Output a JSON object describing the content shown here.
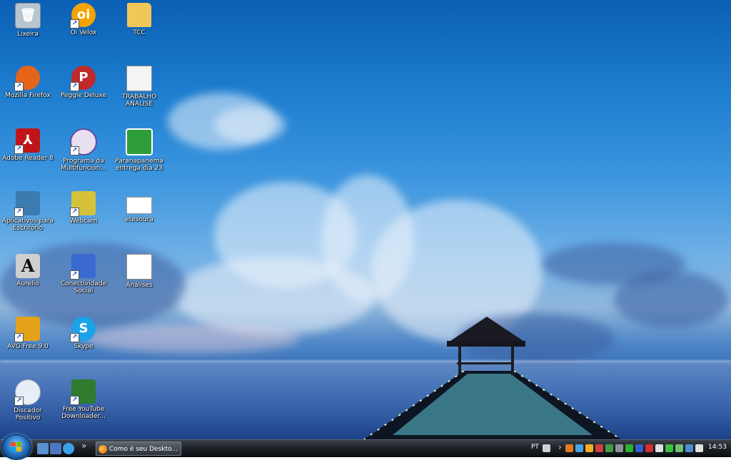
{
  "desktop": {
    "icons": [
      {
        "label": "Lixeira",
        "icon": "recycle-bin-icon",
        "color": "#b8c4d0",
        "symbol": "🗑"
      },
      {
        "label": "Oi Velox",
        "icon": "oi-velox-icon",
        "color": "#f5a300",
        "symbol": "oi"
      },
      {
        "label": "TCC",
        "icon": "folder-icon",
        "color": "#f1c75a",
        "symbol": ""
      },
      {
        "label": "Mozilla Firefox",
        "icon": "firefox-icon",
        "color": "#e5641a",
        "symbol": ""
      },
      {
        "label": "Peggle Deluxe",
        "icon": "peggle-icon",
        "color": "#c02a2a",
        "symbol": "P"
      },
      {
        "label": "TRABALHO ANALISE",
        "icon": "spreadsheet-document-icon",
        "color": "#f4f4f4",
        "symbol": ""
      },
      {
        "label": "Adobe Reader 8",
        "icon": "adobe-reader-icon",
        "color": "#c0141a",
        "symbol": "⅄"
      },
      {
        "label": "Programa da Multifuncion...",
        "icon": "multifunction-printer-icon",
        "color": "#e8e0f0",
        "symbol": ""
      },
      {
        "label": "Paranapanema entrega dia 23",
        "icon": "calc-spreadsheet-icon",
        "color": "#2e9e3a",
        "symbol": ""
      },
      {
        "label": "Aplicativos para Escritório",
        "icon": "office-apps-icon",
        "color": "#3a7bb0",
        "symbol": ""
      },
      {
        "label": "Webcam",
        "icon": "webcam-icon",
        "color": "#d6c23a",
        "symbol": ""
      },
      {
        "label": "etesoura",
        "icon": "document-icon",
        "color": "#ffffff",
        "symbol": ""
      },
      {
        "label": "Aurelio",
        "icon": "aurelio-dictionary-icon",
        "color": "#cfcfcf",
        "symbol": "A"
      },
      {
        "label": "Conectividade Social",
        "icon": "conectividade-social-icon",
        "color": "#3a6ad0",
        "symbol": ""
      },
      {
        "label": "Análises",
        "icon": "text-document-icon",
        "color": "#ffffff",
        "symbol": ""
      },
      {
        "label": "AVG Free 9.0",
        "icon": "avg-antivirus-icon",
        "color": "#e3a21a",
        "symbol": ""
      },
      {
        "label": "Skype",
        "icon": "skype-icon",
        "color": "#1aa3e8",
        "symbol": "S"
      },
      {
        "label": "Discador Positivo",
        "icon": "dialer-icon",
        "color": "#e8eef6",
        "symbol": ""
      },
      {
        "label": "Free YouTube Downloader...",
        "icon": "youtube-downloader-icon",
        "color": "#2e7a2e",
        "symbol": ""
      }
    ]
  },
  "taskbar": {
    "start_icon": "windows-start-orb-icon",
    "quick_launch": [
      {
        "icon": "show-desktop-icon",
        "color": "#5a8fd0"
      },
      {
        "icon": "switch-windows-icon",
        "color": "#4a78c0"
      },
      {
        "icon": "internet-explorer-icon",
        "color": "#3aa0e8"
      }
    ],
    "overflow_symbol": "»",
    "window_button": {
      "label": "Como é seu Deskto...",
      "icon": "firefox-icon"
    },
    "language": "PT",
    "tray_chevron": "›",
    "clock": "14:53",
    "tray_icons": [
      {
        "icon": "keyboard-icon",
        "color": "#d0d0d0"
      },
      {
        "icon": "java-icon",
        "color": "#e07a20"
      },
      {
        "icon": "network-app-icon",
        "color": "#4aa0e0"
      },
      {
        "icon": "msn-icon",
        "color": "#f0b020"
      },
      {
        "icon": "security-icon",
        "color": "#d04040"
      },
      {
        "icon": "avg-tray-icon",
        "color": "#40a040"
      },
      {
        "icon": "display-icon",
        "color": "#9090a0"
      },
      {
        "icon": "update-icon",
        "color": "#30b030"
      },
      {
        "icon": "bluetooth-icon",
        "color": "#3060d0"
      },
      {
        "icon": "antivirus-tray-icon",
        "color": "#d03030"
      },
      {
        "icon": "speaker-tray-icon",
        "color": "#e0e0e0"
      },
      {
        "icon": "check-icon",
        "color": "#40c040"
      },
      {
        "icon": "power-icon",
        "color": "#70c070"
      },
      {
        "icon": "network-icon",
        "color": "#4a90d0"
      },
      {
        "icon": "volume-icon",
        "color": "#e0e0e0"
      }
    ]
  }
}
